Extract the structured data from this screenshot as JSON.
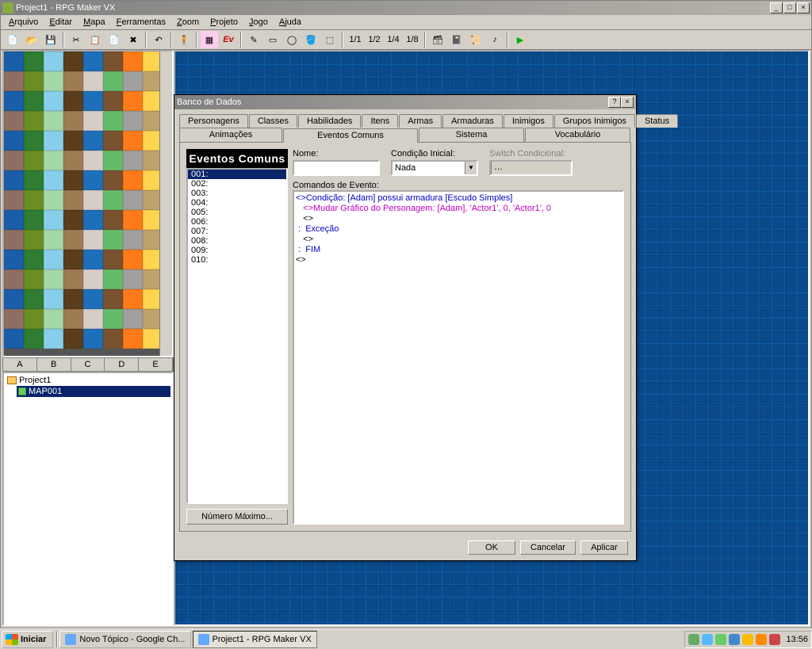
{
  "window": {
    "title": "Project1 - RPG Maker VX",
    "min": "_",
    "max": "□",
    "close": "×"
  },
  "menu": [
    "Arquivo",
    "Editar",
    "Mapa",
    "Ferramentas",
    "Zoom",
    "Projeto",
    "Jogo",
    "Ajuda"
  ],
  "fractions": [
    "1/1",
    "1/2",
    "1/4",
    "1/8"
  ],
  "layer_tabs": [
    "A",
    "B",
    "C",
    "D",
    "E"
  ],
  "tree": {
    "project": "Project1",
    "map": "MAP001"
  },
  "dialog": {
    "title": "Banco de Dados",
    "help": "?",
    "close": "×",
    "tabs_row1": [
      "Personagens",
      "Classes",
      "Habilidades",
      "Itens",
      "Armas",
      "Armaduras",
      "Inimigos",
      "Grupos Inimigos",
      "Status"
    ],
    "tabs_row2": [
      "Animações",
      "Eventos Comuns",
      "Sistema",
      "Vocabulário"
    ],
    "active_tab": "Eventos Comuns",
    "panel_header": "Eventos Comuns",
    "event_items": [
      "001:",
      "002:",
      "003:",
      "004:",
      "005:",
      "006:",
      "007:",
      "008:",
      "009:",
      "010:"
    ],
    "selected_item": "001:",
    "max_button": "Número Máximo...",
    "labels": {
      "name": "Nome:",
      "trigger": "Condição Inicial:",
      "switch": "Switch Condicional:",
      "commands": "Comandos de Evento:"
    },
    "name_value": "",
    "trigger_value": "Nada",
    "switch_value": "",
    "commands": [
      {
        "indent": 0,
        "prefix": "<>",
        "text": "Condição: [Adam] possui armadura [Escudo Simples]",
        "color": "#0000c0"
      },
      {
        "indent": 1,
        "prefix": "<>",
        "text": "Mudar Gráfico do Personagem: [Adam], 'Actor1', 0, 'Actor1', 0",
        "color": "#c000c0"
      },
      {
        "indent": 1,
        "prefix": "<>",
        "text": "",
        "color": "#000"
      },
      {
        "indent": 0,
        "prefix": " :  ",
        "text": "Exceção",
        "color": "#0000c0"
      },
      {
        "indent": 1,
        "prefix": "<>",
        "text": "",
        "color": "#000"
      },
      {
        "indent": 0,
        "prefix": " :  ",
        "text": "FIM",
        "color": "#0000c0"
      },
      {
        "indent": 0,
        "prefix": "<>",
        "text": "",
        "color": "#000"
      }
    ],
    "buttons": {
      "ok": "OK",
      "cancel": "Cancelar",
      "apply": "Aplicar"
    }
  },
  "taskbar": {
    "start": "Iniciar",
    "tasks": [
      {
        "label": "Novo Tópico - Google Ch...",
        "active": false
      },
      {
        "label": "Project1 - RPG Maker VX",
        "active": true
      }
    ],
    "clock": "13:56"
  }
}
